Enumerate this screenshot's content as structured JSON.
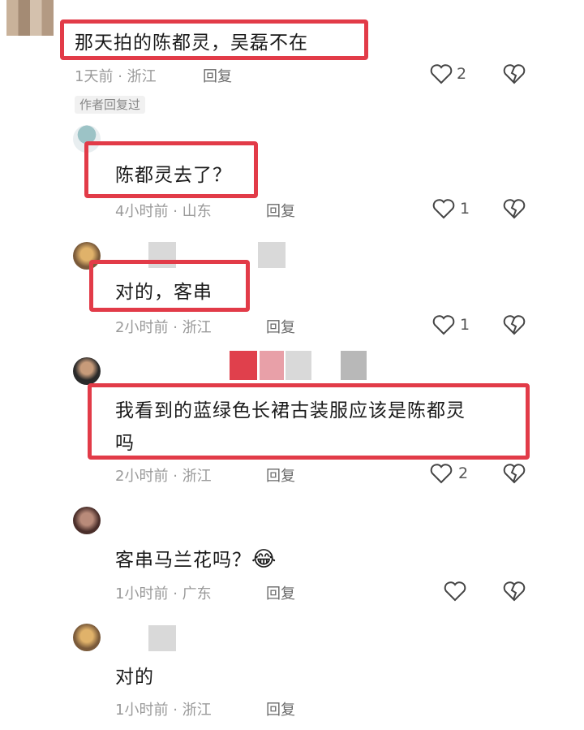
{
  "comments": [
    {
      "text": "那天拍的陈都灵，吴磊不在",
      "time": "1天前",
      "location": "浙江",
      "reply": "回复",
      "likes": "2"
    },
    {
      "text": "陈都灵去了？",
      "time": "4小时前",
      "location": "山东",
      "reply": "回复",
      "likes": "1"
    },
    {
      "text": "对的，客串",
      "time": "2小时前",
      "location": "浙江",
      "reply": "回复",
      "likes": "1"
    },
    {
      "text_line1": "我看到的蓝绿色长裙古装服应该是陈都灵",
      "text_line2": "吗",
      "time": "2小时前",
      "location": "浙江",
      "reply": "回复",
      "likes": "2"
    },
    {
      "text": "客串马兰花吗？",
      "emoji": "😂",
      "time": "1小时前",
      "location": "广东",
      "reply": "回复",
      "likes": ""
    },
    {
      "text": "对的",
      "time": "1小时前",
      "location": "浙江",
      "reply": "回复",
      "likes": ""
    }
  ],
  "author_reply_badge": "作者回复过",
  "separator": "·",
  "colors": {
    "highlight": "#e23b48",
    "meta": "#9a9a9a"
  }
}
